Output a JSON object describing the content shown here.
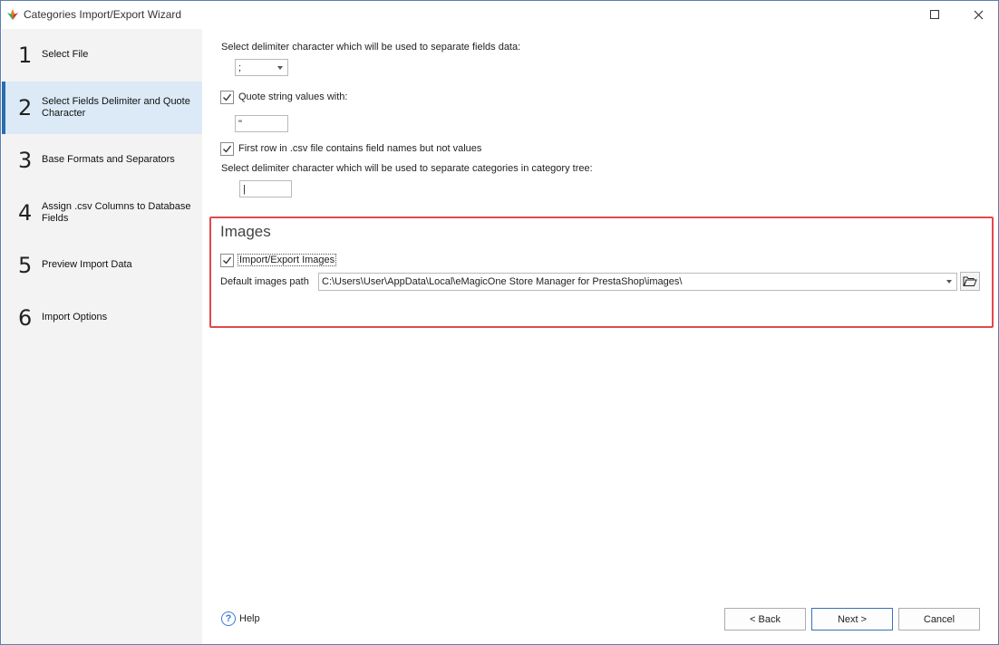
{
  "window": {
    "title": "Categories Import/Export Wizard"
  },
  "steps": [
    {
      "num": "1",
      "label": "Select File"
    },
    {
      "num": "2",
      "label": "Select Fields Delimiter and Quote Character"
    },
    {
      "num": "3",
      "label": "Base Formats and Separators"
    },
    {
      "num": "4",
      "label": "Assign .csv Columns to Database Fields"
    },
    {
      "num": "5",
      "label": "Preview Import Data"
    },
    {
      "num": "6",
      "label": "Import Options"
    }
  ],
  "active_step": 2,
  "form": {
    "delimiter_label": "Select delimiter character which will be used to separate fields data:",
    "delimiter_value": ";",
    "quote_label": "Quote string values with:",
    "quote_checked": true,
    "quote_value": "\"",
    "first_row_label": "First row in .csv file contains field names but not values",
    "first_row_checked": true,
    "category_delimiter_label": "Select delimiter character which will be used to separate categories in category tree:",
    "category_delimiter_value": "|"
  },
  "images": {
    "heading": "Images",
    "import_label": "Import/Export Images",
    "import_checked": true,
    "path_label": "Default images path",
    "path_value": "C:\\Users\\User\\AppData\\Local\\eMagicOne Store Manager for PrestaShop\\images\\"
  },
  "footer": {
    "help_label": "Help",
    "back_label": "< Back",
    "next_label": "Next >",
    "cancel_label": "Cancel"
  },
  "colors": {
    "accent": "#2b6cb0",
    "active_step_bg": "#dbeaf6",
    "highlight_frame": "#e04a4a"
  },
  "icons": {
    "app": "app-logo-icon",
    "maximize": "maximize-icon",
    "close": "close-icon",
    "checkbox": "check-icon",
    "dropdown": "chevron-down-icon",
    "folder": "folder-open-icon",
    "help": "help-icon"
  }
}
